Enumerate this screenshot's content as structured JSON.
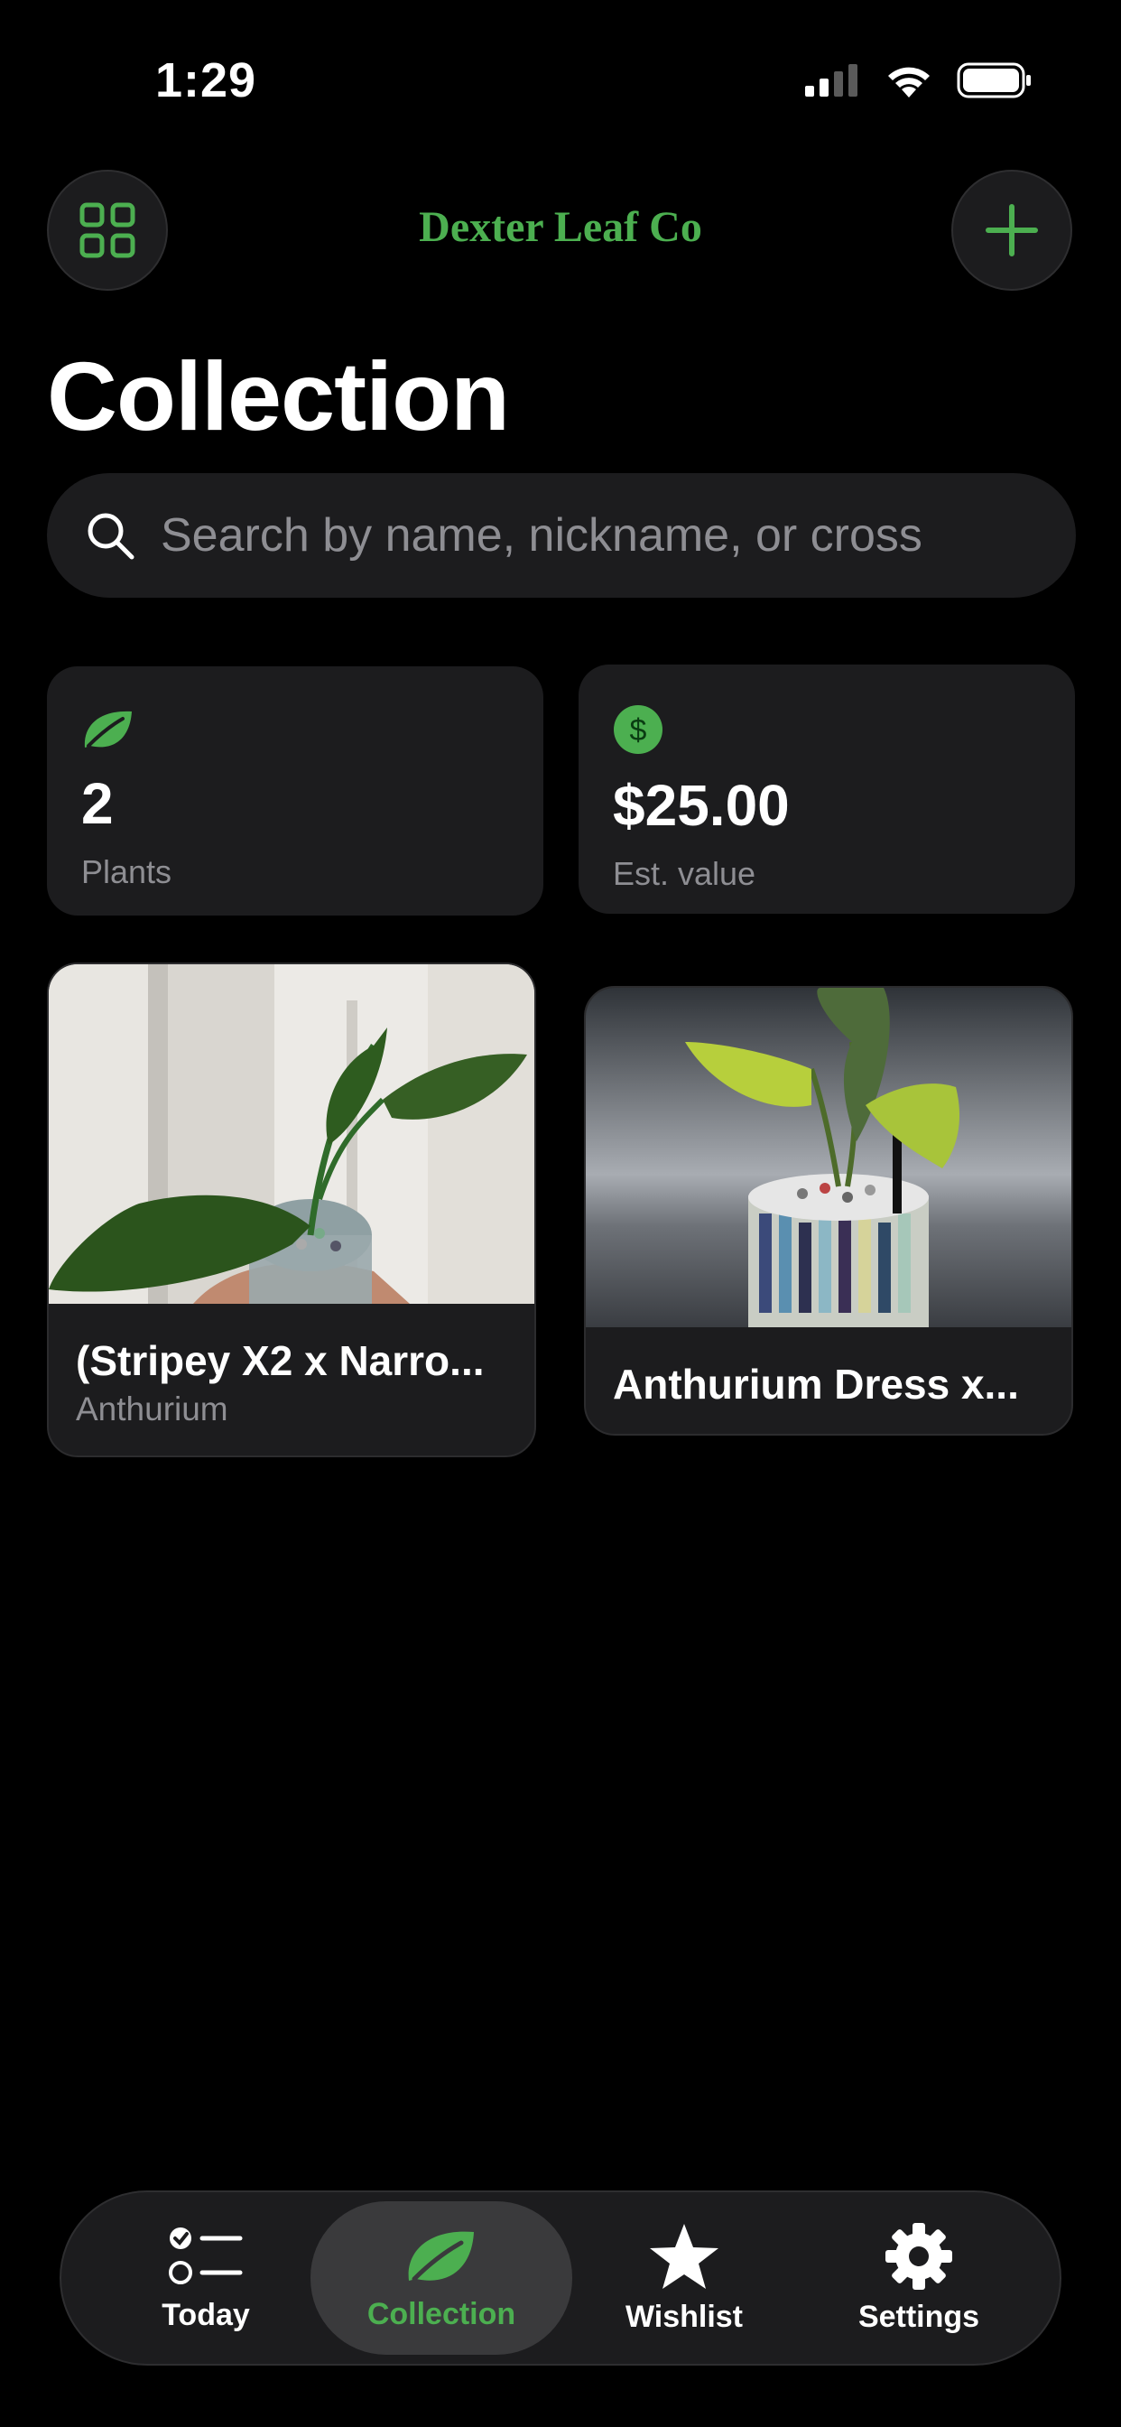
{
  "status_bar": {
    "time": "1:29"
  },
  "header": {
    "brand": "Dexter Leaf Co",
    "title": "Collection"
  },
  "search": {
    "placeholder": "Search by name, nickname, or cross"
  },
  "stats": {
    "plants": {
      "value": "2",
      "label": "Plants",
      "icon": "leaf-icon"
    },
    "value": {
      "value": "$25.00",
      "label": "Est. value",
      "icon": "dollar-icon"
    }
  },
  "plants": [
    {
      "name": "(Stripey X2 x Narro...",
      "genus": "Anthurium"
    },
    {
      "name": "Anthurium Dress x..."
    }
  ],
  "tabs": [
    {
      "label": "Today",
      "icon": "checklist-icon"
    },
    {
      "label": "Collection",
      "icon": "leaf-icon"
    },
    {
      "label": "Wishlist",
      "icon": "star-icon"
    },
    {
      "label": "Settings",
      "icon": "gear-icon"
    }
  ],
  "colors": {
    "accent": "#4caf50",
    "background": "#000000",
    "card": "#1c1c1e",
    "muted": "#8e8e93"
  }
}
